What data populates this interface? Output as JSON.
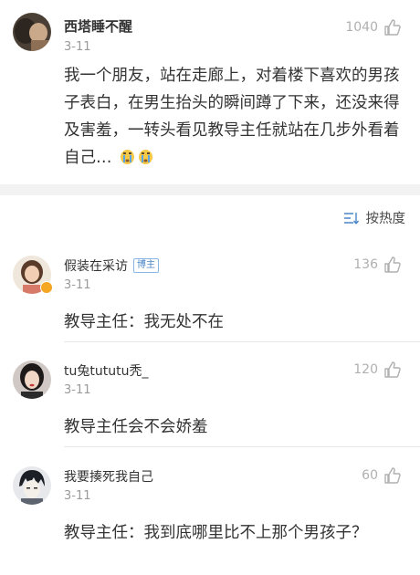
{
  "post": {
    "author": "西塔睡不醒",
    "date": "3-11",
    "likes": "1040",
    "body": "我一个朋友，站在走廊上，对着楼下喜欢的男孩子表白，在男生抬头的瞬间蹲了下来，还没来得及害羞，一转头看见教导主任就站在几步外看着自己…"
  },
  "sort": {
    "label": "按热度",
    "icon": "sort-icon"
  },
  "comments": [
    {
      "author": "假装在采访",
      "badge": "博主",
      "date": "3-11",
      "likes": "136",
      "text": "教导主任：我无处不在"
    },
    {
      "author": "tu兔tututu秃_",
      "date": "3-11",
      "likes": "120",
      "text": "教导主任会不会娇羞"
    },
    {
      "author": "我要揍死我自己",
      "date": "3-11",
      "likes": "60",
      "text": "教导主任：我到底哪里比不上那个男孩子？"
    }
  ],
  "colors": {
    "text": "#333333",
    "muted": "#9a9a9a",
    "like_icon": "#b0b0b0",
    "badge": "#4a86c8",
    "section_gap": "#f2f2f2"
  }
}
